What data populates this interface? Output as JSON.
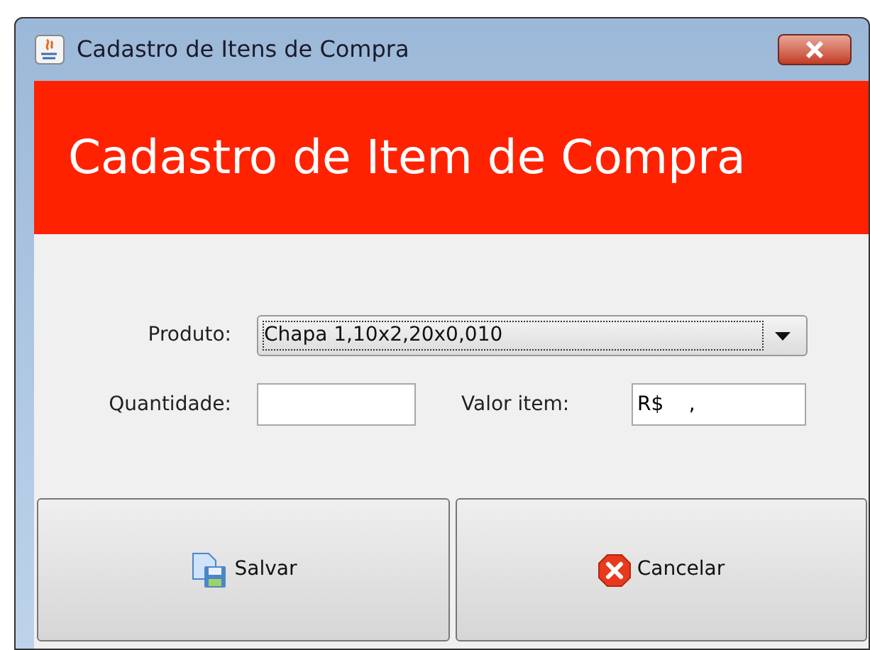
{
  "window": {
    "title": "Cadastro de Itens de Compra"
  },
  "header": {
    "title": "Cadastro de Item de Compra"
  },
  "form": {
    "produto": {
      "label": "Produto:",
      "value": "Chapa 1,10x2,20x0,010"
    },
    "quantidade": {
      "label": "Quantidade:"
    },
    "valor_item": {
      "label": "Valor item:",
      "value": "R$    ,"
    }
  },
  "buttons": [
    {
      "kind": "save",
      "label": "Salvar"
    },
    {
      "kind": "cancel",
      "label": "Cancelar"
    }
  ]
}
